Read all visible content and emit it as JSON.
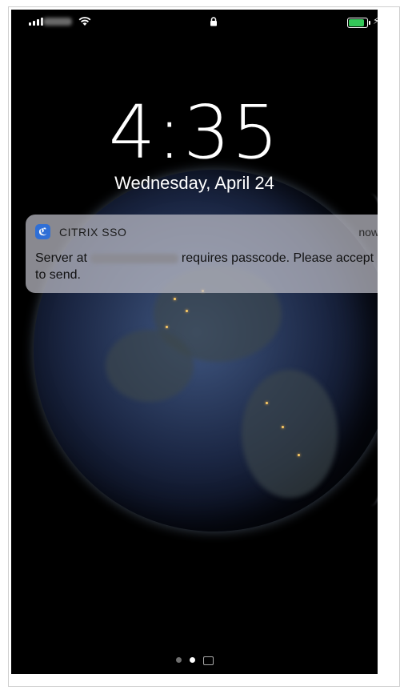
{
  "status_bar": {
    "signal_icon": "cellular-signal-icon",
    "wifi_icon": "wifi-icon",
    "lock_icon": "lock-icon",
    "battery_icon": "battery-icon",
    "battery_level": 0.95,
    "charging_icon": "charging-bolt-icon",
    "battery_color": "#34c759"
  },
  "lock_screen": {
    "time": "4:35",
    "date": "Wednesday, April 24"
  },
  "notification": {
    "app_icon": "citrix-sso-icon",
    "app_name": "CITRIX SSO",
    "time": "now",
    "body_prefix": "Server at",
    "body_suffix": "requires passcode. Please accept to send.",
    "accent_color": "#2f6fd6"
  },
  "page_indicator": {
    "pages": 3,
    "active_index": 1,
    "camera_icon": "camera-icon"
  }
}
